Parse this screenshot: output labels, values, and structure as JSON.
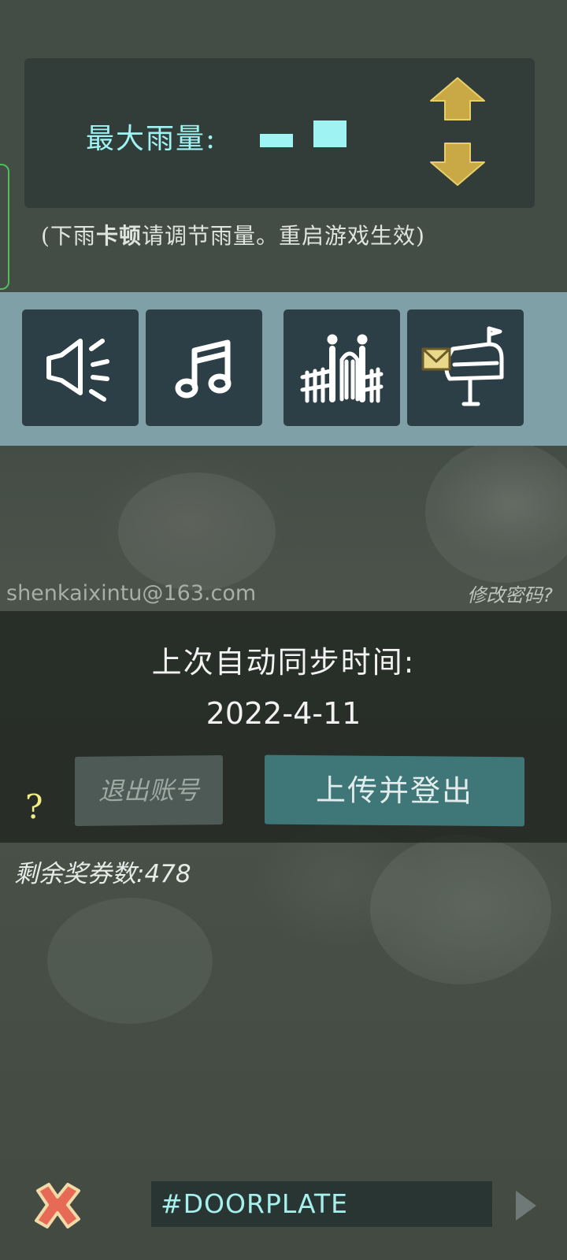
{
  "rain": {
    "label": "最大雨量:",
    "note_prefix": "(下雨",
    "note_bold": "卡顿",
    "note_suffix": "请调节雨量。重启游戏生效)"
  },
  "icons": [
    {
      "name": "sound-icon"
    },
    {
      "name": "music-icon"
    },
    {
      "name": "fence-icon"
    },
    {
      "name": "mailbox-icon"
    }
  ],
  "account": {
    "email": "shenkaixintu@163.com",
    "change_password": "修改密码?"
  },
  "sync": {
    "title": "上次自动同步时间:",
    "date": "2022-4-11",
    "logout_label": "退出账号",
    "upload_label": "上传并登出",
    "help": "?"
  },
  "tickets": {
    "label": "剩余奖券数:478"
  },
  "bottom": {
    "doorplate": "#DOORPLATE"
  },
  "colors": {
    "accent_cyan": "#9ff3f3",
    "arrow_gold": "#c9a846",
    "upload_teal": "#3f7677",
    "close_red": "#e66a56"
  }
}
